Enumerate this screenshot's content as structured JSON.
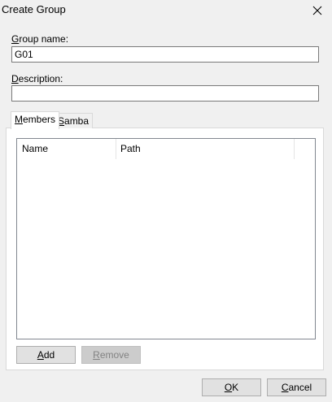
{
  "window": {
    "title": "Create Group"
  },
  "fields": {
    "group_name": {
      "label_first": "G",
      "label_rest": "roup name:",
      "value": "G01"
    },
    "description": {
      "label_first": "D",
      "label_rest": "escription:",
      "value": ""
    }
  },
  "tabs": [
    {
      "first": "M",
      "rest": "embers",
      "active": true
    },
    {
      "first": "S",
      "rest": "amba",
      "active": false
    }
  ],
  "members_list": {
    "columns": [
      "Name",
      "Path"
    ],
    "rows": []
  },
  "buttons": {
    "add": {
      "first": "A",
      "rest": "dd"
    },
    "remove": {
      "first": "R",
      "rest": "emove"
    },
    "ok": {
      "first": "O",
      "rest": "K"
    },
    "cancel": {
      "first": "C",
      "rest": "ancel"
    }
  }
}
